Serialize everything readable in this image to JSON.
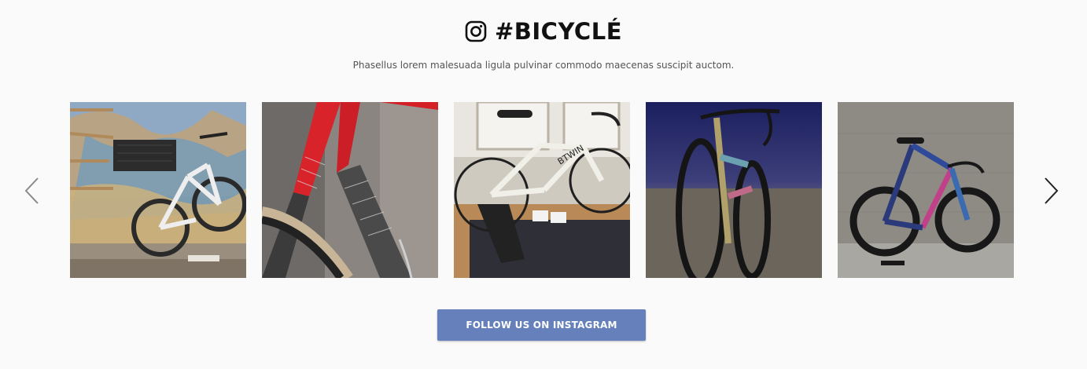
{
  "header": {
    "title": "#BICYCLÉ",
    "subtitle": "Phasellus lorem malesuada ligula pulvinar commodo maecenas suscipit auctom.",
    "icon": "instagram-icon"
  },
  "carousel": {
    "prev_icon": "chevron-left-icon",
    "next_icon": "chevron-right-icon",
    "items": [
      {
        "name": "photo-bike-graffiti-wall",
        "watermark": ""
      },
      {
        "name": "photo-red-frame-closeup",
        "watermark": ""
      },
      {
        "name": "photo-white-road-bike-trainer",
        "watermark": "BTWIN"
      },
      {
        "name": "photo-painted-gravel-bike",
        "watermark": ""
      },
      {
        "name": "photo-blue-pink-road-bike",
        "watermark": ""
      }
    ]
  },
  "cta": {
    "label": "FOLLOW US ON INSTAGRAM",
    "color": "#6580bb"
  }
}
